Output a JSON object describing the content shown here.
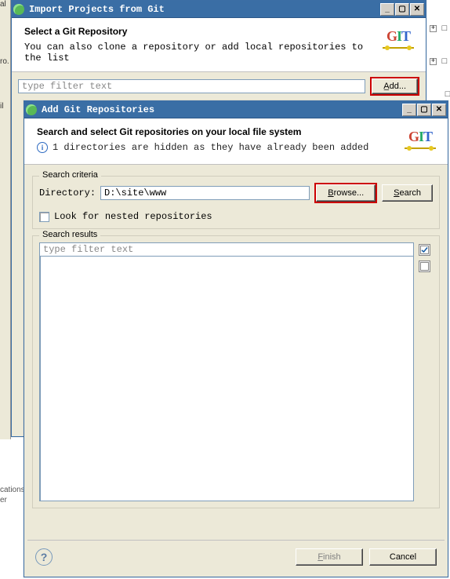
{
  "bg": {
    "left_label_1": "cations",
    "left_label_2": "er"
  },
  "win1": {
    "title": "Import Projects from Git",
    "header_title": "Select a Git Repository",
    "header_sub": "You can also clone a repository or add local repositories to the list",
    "filter_placeholder": "type filter text",
    "add_button": "Add..."
  },
  "win2": {
    "title": "Add Git Repositories",
    "header_title": "Search and select Git repositories on your local file system",
    "header_sub": "1 directories are hidden as they have already been added",
    "criteria": {
      "legend": "Search criteria",
      "dir_label_pre": "D",
      "dir_label_post": "irectory:",
      "dir_value": "D:\\site\\www",
      "browse_pre": "B",
      "browse_post": "rowse...",
      "search_pre": "S",
      "search_post": "earch",
      "nested_pre": "L",
      "nested_post": "ook for nested repositories"
    },
    "results": {
      "legend": "Search results",
      "filter_placeholder": "type filter text"
    },
    "finish_pre": "F",
    "finish_post": "inish",
    "cancel": "Cancel"
  }
}
